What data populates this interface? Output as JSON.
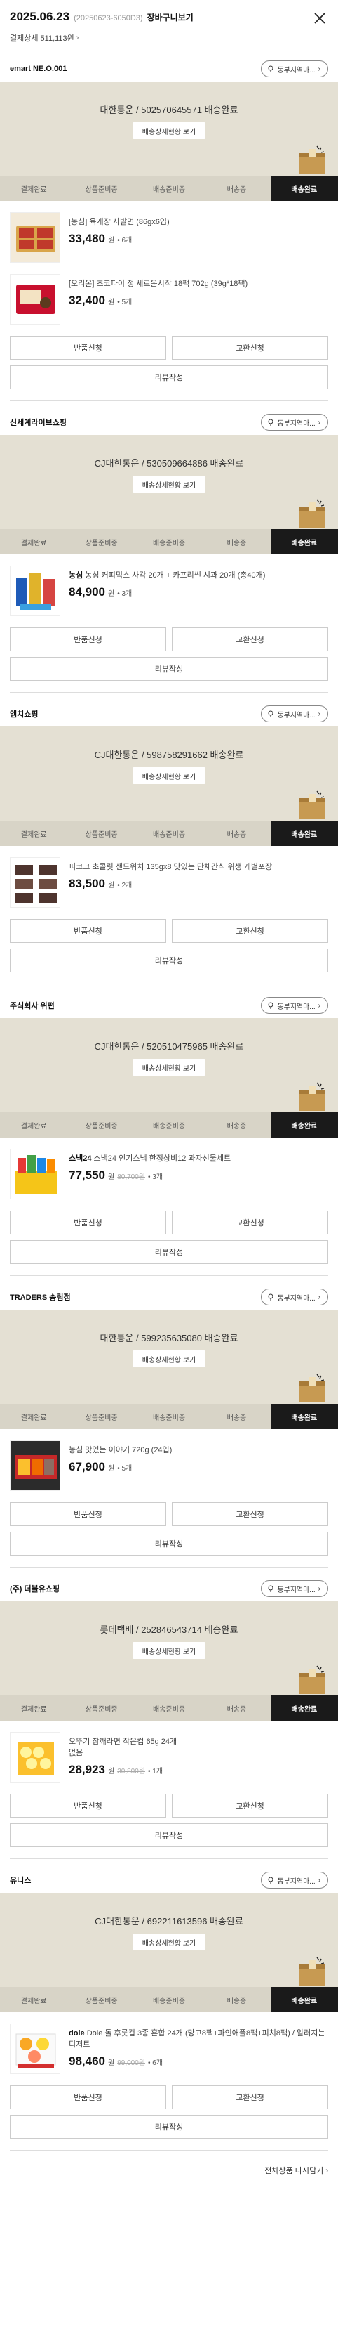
{
  "header": {
    "date": "2025.06.23",
    "order_no": "(20250623-6050D3)",
    "title": "장바구니보기",
    "payment_detail": "결제상세 511,113원"
  },
  "steps": [
    "결제완료",
    "상품준비중",
    "배송준비중",
    "배송중",
    "배송완료"
  ],
  "labels": {
    "track": "배송상세현황 보기",
    "region": "동부지역마...",
    "return": "반품신청",
    "exchange": "교환신청",
    "review": "리뷰작성",
    "won": "원",
    "footer": "전체상품 다시담기"
  },
  "stores": [
    {
      "name": "emart NE.O.001",
      "carrier": "대한통운 / 502570645571 배송완료",
      "items": [
        {
          "name": "[농심] 육개장 사발면 (86gx6입)",
          "brand": "",
          "price": "33,480",
          "orig": "",
          "qty": "6개",
          "thumb": "noodle"
        },
        {
          "name": "[오리온] 초코파이 정 세로운시작 18팩 702g (39g*18팩)",
          "brand": "",
          "price": "32,400",
          "orig": "",
          "qty": "5개",
          "thumb": "choco"
        }
      ]
    },
    {
      "name": "신세계라이브쇼핑",
      "carrier": "CJ대한통운 / 530509664886 배송완료",
      "items": [
        {
          "name": "농심 커피믹스 사각 20개 + 카프리썬 시과 20개 (총40개)",
          "brand": "농심",
          "price": "84,900",
          "orig": "",
          "qty": "3개",
          "thumb": "drink"
        }
      ]
    },
    {
      "name": "엠치쇼핑",
      "carrier": "CJ대한통운 / 598758291662 배송완료",
      "items": [
        {
          "name": "피코크 초콜릿 샌드위치 135gx8 맛있는 단체간식 위생 개별포장",
          "brand": "",
          "price": "83,500",
          "orig": "",
          "qty": "2개",
          "thumb": "sand"
        }
      ]
    },
    {
      "name": "주식회사 위편",
      "carrier": "CJ대한통운 / 520510475965 배송완료",
      "items": [
        {
          "name": "스낵24 인기스낵 한정상비12 과자선물세트",
          "brand": "스낵24",
          "price": "77,550",
          "orig": "80,700원",
          "qty": "3개",
          "thumb": "snack"
        }
      ]
    },
    {
      "name": "TRADERS 송림점",
      "carrier": "대한통운 / 599235635080 배송완료",
      "items": [
        {
          "name": "농심 맛있는 이야기 720g (24입)",
          "brand": "",
          "price": "67,900",
          "orig": "",
          "qty": "5개",
          "thumb": "box"
        }
      ]
    },
    {
      "name": "(주) 더블유쇼핑",
      "carrier": "롯데택배 / 252846543714 배송완료",
      "items": [
        {
          "name": "오뚜기 참깨라면 작은컵 65g 24개",
          "sub": "없음",
          "brand": "",
          "price": "28,923",
          "orig": "30,800원",
          "qty": "1개",
          "thumb": "cup"
        }
      ]
    },
    {
      "name": "유니스",
      "carrier": "CJ대한통운 / 692211613596 배송완료",
      "items": [
        {
          "name": "Dole 돌 후룻컵 3종 혼합 24개 (망고8팩+파인애플8팩+피치8팩) / 알러지는 디저트",
          "brand": "dole",
          "price": "98,460",
          "orig": "99,000원",
          "qty": "6개",
          "thumb": "fruit"
        }
      ]
    }
  ]
}
